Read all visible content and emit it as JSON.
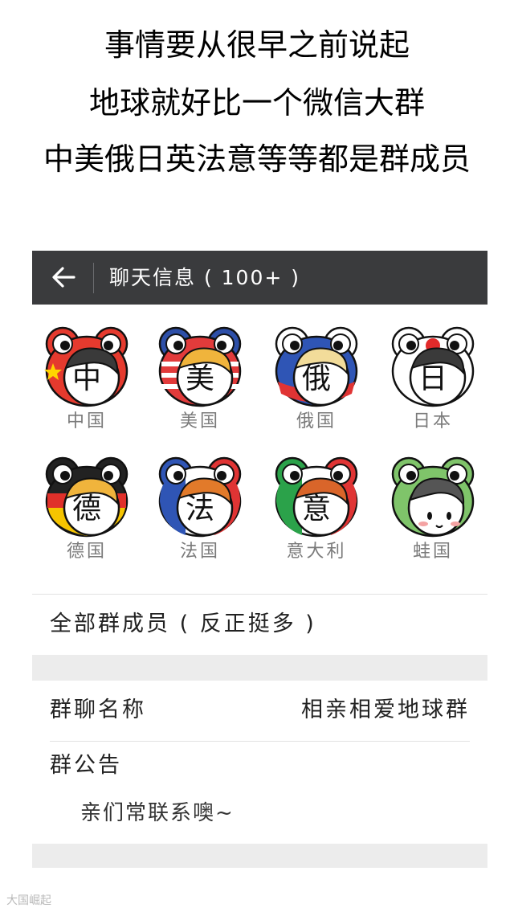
{
  "caption": {
    "line1": "事情要从很早之前说起",
    "line2": "地球就好比一个微信大群",
    "line3": "中美俄日英法意等等都是群成员"
  },
  "header": {
    "title": "聊天信息 ( 100+ )",
    "back_icon": "back-arrow-icon",
    "background": "#3a3b3d"
  },
  "members": [
    {
      "face_char": "中",
      "name": "中国",
      "flag": "china"
    },
    {
      "face_char": "美",
      "name": "美国",
      "flag": "usa"
    },
    {
      "face_char": "俄",
      "name": "俄国",
      "flag": "russia"
    },
    {
      "face_char": "日",
      "name": "日本",
      "flag": "japan"
    },
    {
      "face_char": "德",
      "name": "德国",
      "flag": "germany"
    },
    {
      "face_char": "法",
      "name": "法国",
      "flag": "france"
    },
    {
      "face_char": "意",
      "name": "意大利",
      "flag": "italy"
    },
    {
      "face_char": "",
      "name": "蛙国",
      "flag": "frog"
    }
  ],
  "settings": {
    "all_members_label": "全部群成员 ( 反正挺多 )",
    "group_name_label": "群聊名称",
    "group_name_value": "相亲相爱地球群",
    "announcement_label": "群公告",
    "announcement_text": "亲们常联系噢~"
  },
  "watermark": "大国崛起"
}
